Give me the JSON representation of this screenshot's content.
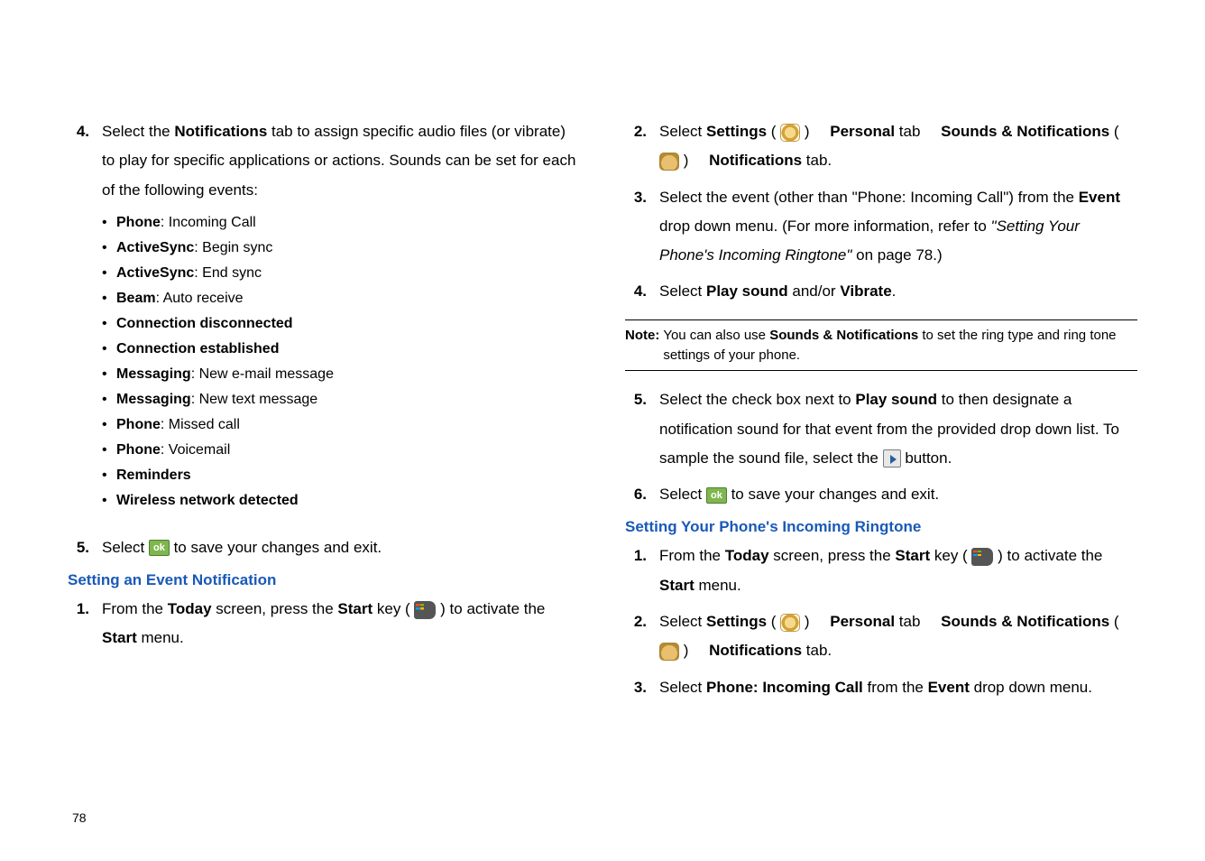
{
  "page_number": "78",
  "left": {
    "step4": {
      "num": "4.",
      "pre": "Select the ",
      "bold1": "Notifications",
      "post": " tab to assign specific audio files (or vibrate) to play for specific applications or actions. Sounds can be set for each of the following events:"
    },
    "bullets": [
      {
        "b": "Phone",
        "rest": ": Incoming Call"
      },
      {
        "b": "ActiveSync",
        "rest": ": Begin sync"
      },
      {
        "b": "ActiveSync",
        "rest": ": End sync"
      },
      {
        "b": "Beam",
        "rest": ": Auto receive"
      },
      {
        "b": "Connection disconnected",
        "rest": ""
      },
      {
        "b": "Connection established",
        "rest": ""
      },
      {
        "b": "Messaging",
        "rest": ": New e-mail message"
      },
      {
        "b": "Messaging",
        "rest": ": New text message"
      },
      {
        "b": "Phone",
        "rest": ": Missed call"
      },
      {
        "b": "Phone",
        "rest": ": Voicemail"
      },
      {
        "b": "Reminders",
        "rest": ""
      },
      {
        "b": "Wireless network detected",
        "rest": ""
      }
    ],
    "step5": {
      "num": "5.",
      "pre": "Select ",
      "post": " to save your changes and exit."
    },
    "heading1": "Setting an Event Notification",
    "step1": {
      "num": "1.",
      "pre": "From the ",
      "b1": "Today",
      "mid1": " screen, press the ",
      "b2": "Start",
      "mid2": " key ( ",
      "mid3": " ) to activate the ",
      "b3": "Start",
      "post": " menu."
    }
  },
  "right": {
    "step2": {
      "num": "2.",
      "pre": "Select ",
      "b1": "Settings",
      "p1a": " ( ",
      "p1b": " ) ",
      "b2": "Personal",
      "tab1": " tab ",
      "b3": "Sounds & Notifications",
      "p2a": " ( ",
      "p2b": " ) ",
      "b4": "Notifications",
      "post": " tab."
    },
    "step3": {
      "num": "3.",
      "pre": "Select the event (other than \"Phone: Incoming Call\") from the ",
      "b1": "Event",
      "mid": " drop down menu. (For more information, refer to ",
      "it": "\"Setting Your Phone's Incoming Ringtone\" ",
      "post": " on page 78.)"
    },
    "step4": {
      "num": "4.",
      "pre": "Select ",
      "b1": "Play sound",
      "mid": " and/or ",
      "b2": "Vibrate",
      "post": "."
    },
    "note": {
      "label": "Note:",
      "pre": " You can also use ",
      "b1": "Sounds & Notifications",
      "post": " to set the ring type and ring tone settings of your phone."
    },
    "step5": {
      "num": "5.",
      "pre": "Select the check box next to ",
      "b1": "Play sound",
      "mid": " to then designate a notification sound for that event from the provided drop down list. To sample the sound file, select the ",
      "post": " button."
    },
    "step6": {
      "num": "6.",
      "pre": "Select ",
      "post": " to save your changes and exit."
    },
    "heading2": "Setting Your Phone's Incoming Ringtone",
    "r_step1": {
      "num": "1.",
      "pre": "From the ",
      "b1": "Today",
      "mid1": " screen, press the ",
      "b2": "Start",
      "mid2": " key ( ",
      "mid3": " ) to activate the ",
      "b3": "Start",
      "post": " menu."
    },
    "r_step2": {
      "num": "2.",
      "pre": "Select ",
      "b1": "Settings",
      "p1a": " ( ",
      "p1b": " ) ",
      "b2": "Personal",
      "tab1": " tab ",
      "b3": "Sounds & Notifications",
      "p2a": " ( ",
      "p2b": " ) ",
      "b4": "Notifications",
      "post": " tab."
    },
    "r_step3": {
      "num": "3.",
      "pre": "Select ",
      "b1": "Phone: Incoming Call",
      "mid": " from the ",
      "b2": "Event",
      "post": " drop down menu."
    }
  },
  "icons": {
    "ok_label": "ok"
  }
}
